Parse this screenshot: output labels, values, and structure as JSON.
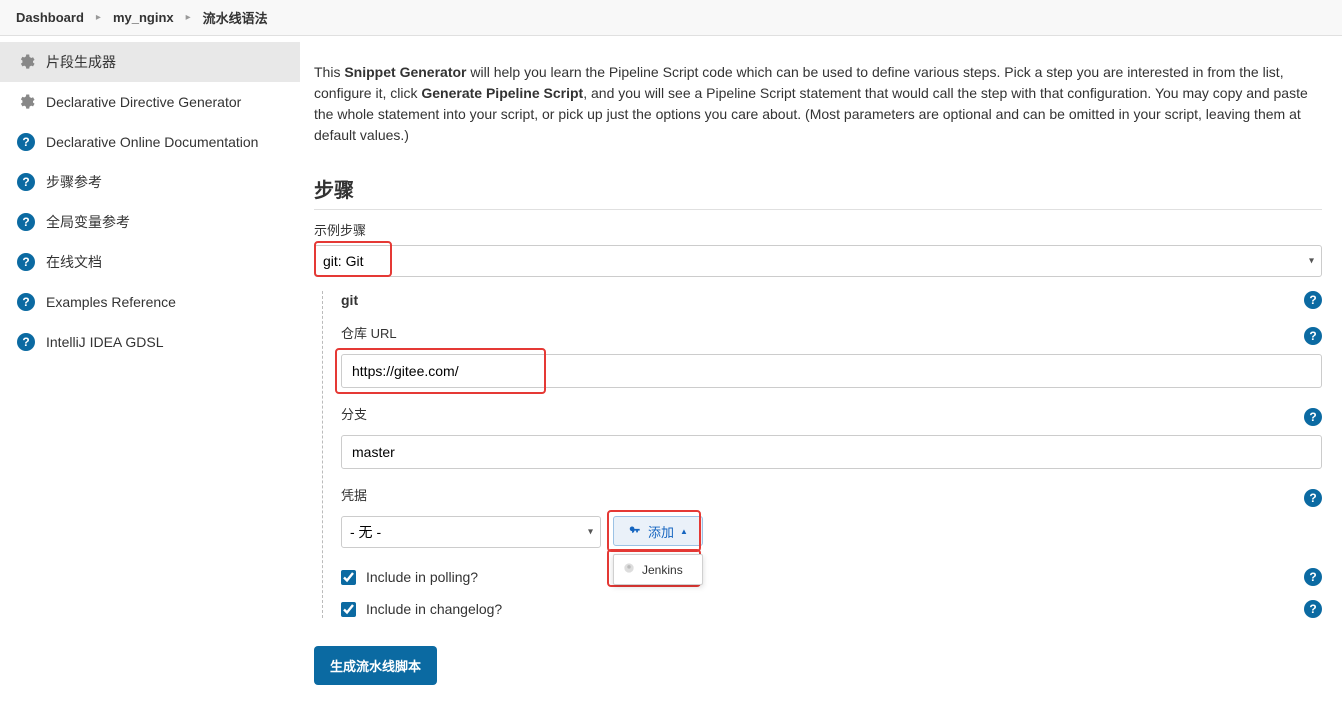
{
  "breadcrumb": {
    "dashboard": "Dashboard",
    "project": "my_nginx",
    "page": "流水线语法"
  },
  "sidebar": {
    "items": [
      {
        "id": "snippet-generator",
        "label": "片段生成器",
        "icon": "gear"
      },
      {
        "id": "declarative-directive",
        "label": "Declarative Directive Generator",
        "icon": "gear"
      },
      {
        "id": "declarative-docs",
        "label": "Declarative Online Documentation",
        "icon": "help"
      },
      {
        "id": "steps-ref",
        "label": "步骤参考",
        "icon": "help"
      },
      {
        "id": "global-var-ref",
        "label": "全局变量参考",
        "icon": "help"
      },
      {
        "id": "online-docs",
        "label": "在线文档",
        "icon": "help"
      },
      {
        "id": "examples-ref",
        "label": "Examples Reference",
        "icon": "help"
      },
      {
        "id": "intellij-gdsl",
        "label": "IntelliJ IDEA GDSL",
        "icon": "help"
      }
    ]
  },
  "intro": {
    "prefix": "This ",
    "strong1": "Snippet Generator",
    "mid1": " will help you learn the Pipeline Script code which can be used to define various steps. Pick a step you are interested in from the list, configure it, click ",
    "strong2": "Generate Pipeline Script",
    "mid2": ", and you will see a Pipeline Script statement that would call the step with that configuration. You may copy and paste the whole statement into your script, or pick up just the options you care about. (Most parameters are optional and can be omitted in your script, leaving them at default values.)"
  },
  "steps": {
    "heading": "步骤",
    "sample_label": "示例步骤",
    "selected_step": "git: Git",
    "git_label": "git",
    "repo_url_label": "仓库 URL",
    "repo_url_value": "https://gitee.com/",
    "branch_label": "分支",
    "branch_value": "master",
    "credentials_label": "凭据",
    "credentials_selected": "- 无 -",
    "add_label": "添加",
    "jenkins_label": "Jenkins",
    "include_polling_label": "Include in polling?",
    "include_changelog_label": "Include in changelog?",
    "generate_button": "生成流水线脚本"
  }
}
